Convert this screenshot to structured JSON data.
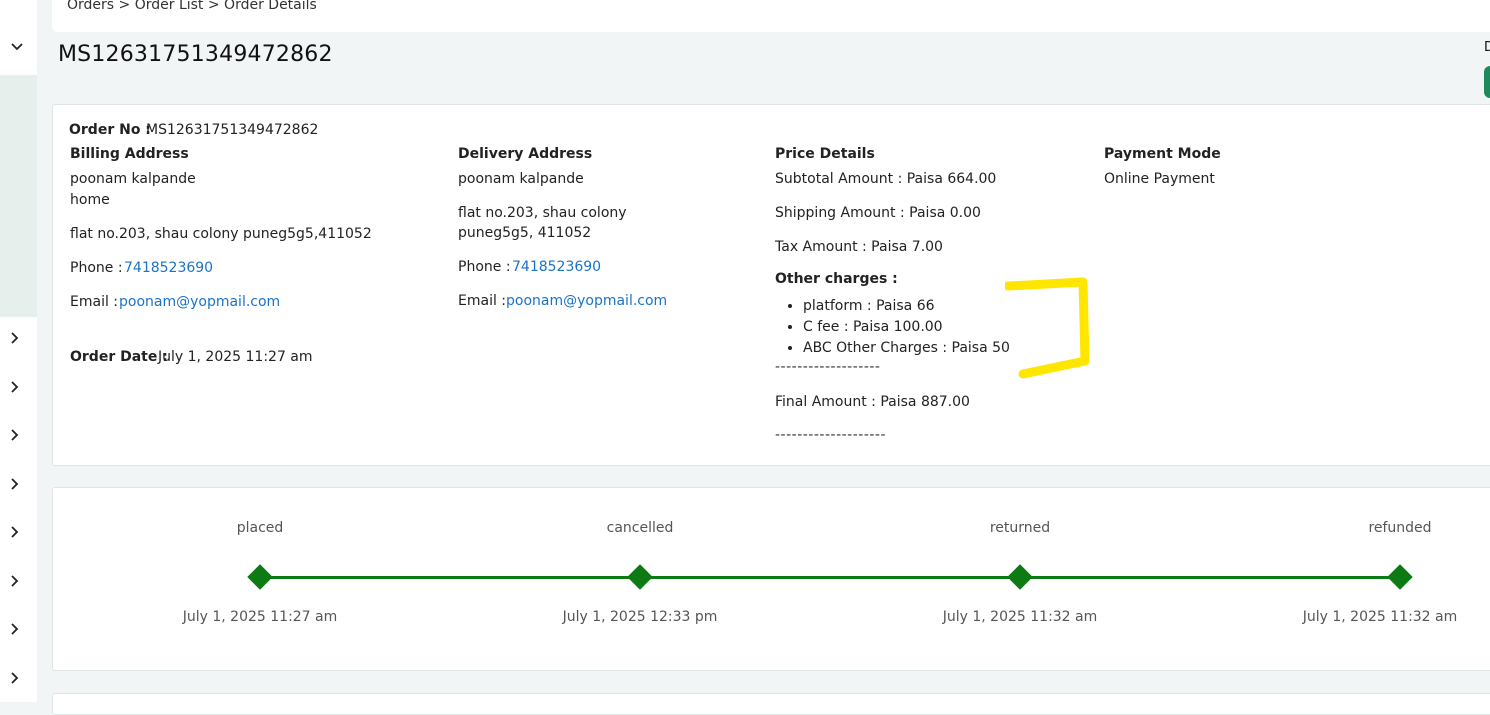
{
  "breadcrumb": "Orders > Order List > Order Details",
  "page_title": "MS12631751349472862",
  "top_right_label": "D",
  "order": {
    "order_no_label": "Order No :",
    "order_no_value": "MS12631751349472862",
    "order_date_label": "Order Date :",
    "order_date_value": "July 1, 2025 11:27 am"
  },
  "billing": {
    "heading": "Billing Address",
    "name": "poonam kalpande",
    "type": "home",
    "address": "flat no.203, shau colony puneg5g5,411052",
    "phone_label": "Phone :",
    "phone": "7418523690",
    "email_label": "Email :",
    "email": "poonam@yopmail.com"
  },
  "delivery": {
    "heading": "Delivery Address",
    "name": "poonam kalpande",
    "address_line1": "flat no.203, shau colony",
    "address_line2": "puneg5g5, 411052",
    "phone_label": "Phone :",
    "phone": "7418523690",
    "email_label": "Email :",
    "email": "poonam@yopmail.com"
  },
  "price": {
    "heading": "Price Details",
    "subtotal": "Subtotal Amount : Paisa 664.00",
    "shipping": "Shipping Amount : Paisa 0.00",
    "tax": "Tax Amount : Paisa  7.00",
    "other_heading": "Other charges :",
    "other_items": [
      "platform :  Paisa  66",
      "C fee :  Paisa  100.00",
      "ABC Other Charges :  Paisa  50"
    ],
    "separator1": "-------------------",
    "final": "Final Amount : Paisa  887.00",
    "separator2": "--------------------"
  },
  "payment": {
    "heading": "Payment Mode",
    "value": "Online Payment"
  },
  "timeline": [
    {
      "status": "placed",
      "date": "July 1, 2025 11:27 am"
    },
    {
      "status": "cancelled",
      "date": "July 1, 2025 12:33 pm"
    },
    {
      "status": "returned",
      "date": "July 1, 2025 11:32 am"
    },
    {
      "status": "refunded",
      "date": "July 1, 2025 11:32 am"
    }
  ],
  "colors": {
    "timeline": "#0d7a13",
    "link": "#1a73c9",
    "highlight_mark": "#ffe600",
    "accent_button": "#1d8a5e"
  }
}
